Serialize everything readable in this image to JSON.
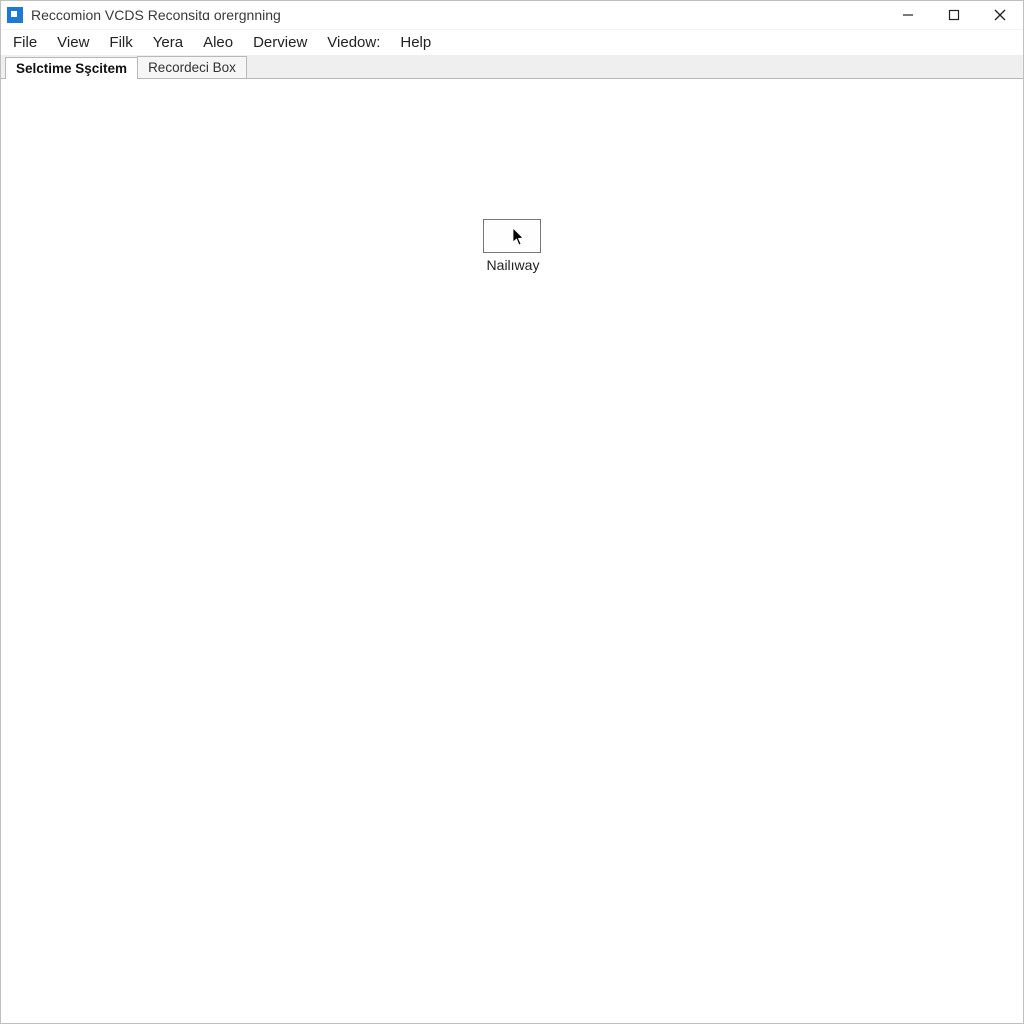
{
  "window": {
    "title": "Reccomion VCDS Reconsitɑ orergnning"
  },
  "menu": {
    "items": [
      "File",
      "View",
      "Filk",
      "Yera",
      "Aleo",
      "Derview",
      "Viedow:",
      "Help"
    ]
  },
  "tabs": {
    "items": [
      {
        "label": "Selctime Sşcitem",
        "active": true
      },
      {
        "label": "Recordeci Box",
        "active": false
      }
    ]
  },
  "canvas": {
    "item_label": "Nailıway"
  }
}
